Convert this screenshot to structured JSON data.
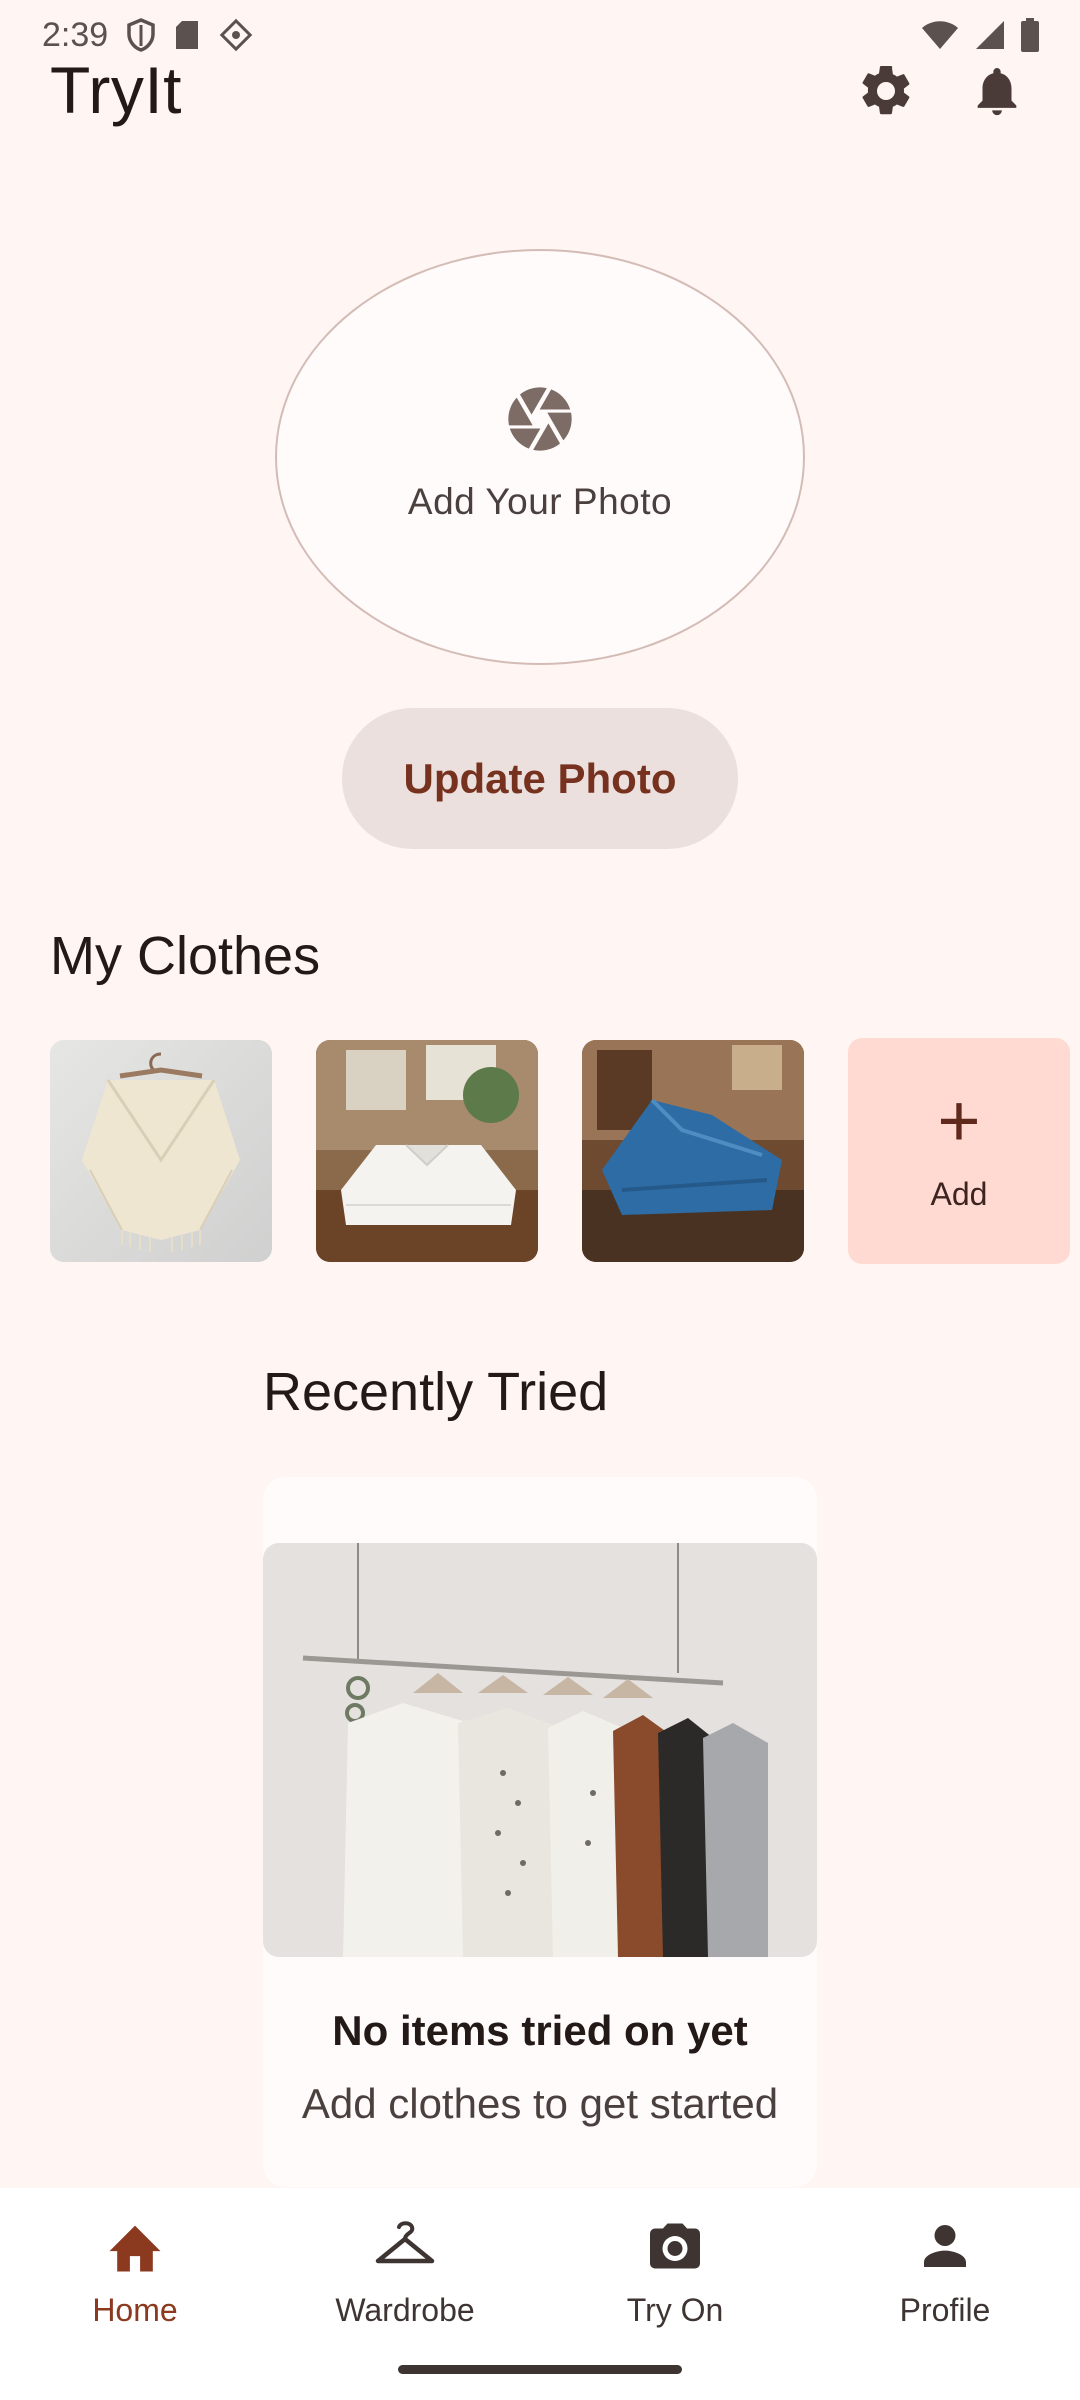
{
  "status_bar": {
    "time": "2:39",
    "icons": [
      "shield-icon",
      "sd-card-icon",
      "app-icon",
      "wifi-icon",
      "signal-icon",
      "battery-icon"
    ]
  },
  "app_bar": {
    "title": "TryIt",
    "actions": [
      "settings-icon",
      "notifications-icon"
    ]
  },
  "photo": {
    "label": "Add Your Photo",
    "icon": "camera-shutter-icon",
    "update_button": "Update Photo"
  },
  "my_clothes": {
    "title": "My Clothes",
    "items": [
      {
        "name": "cream-knit-poncho"
      },
      {
        "name": "folded-white-shirt"
      },
      {
        "name": "folded-blue-jeans"
      }
    ],
    "add_label": "Add"
  },
  "recently_tried": {
    "title": "Recently Tried",
    "empty_title": "No items tried on yet",
    "empty_subtitle": "Add clothes to get started"
  },
  "bottom_nav": {
    "items": [
      {
        "label": "Home",
        "icon": "home-icon",
        "active": true
      },
      {
        "label": "Wardrobe",
        "icon": "hanger-icon",
        "active": false
      },
      {
        "label": "Try On",
        "icon": "camera-icon",
        "active": false
      },
      {
        "label": "Profile",
        "icon": "person-icon",
        "active": false
      }
    ]
  },
  "colors": {
    "background": "#FFF5F3",
    "accent": "#8B3A20",
    "button_bg": "#EBE0DE",
    "add_tile": "#FFDAD3"
  }
}
